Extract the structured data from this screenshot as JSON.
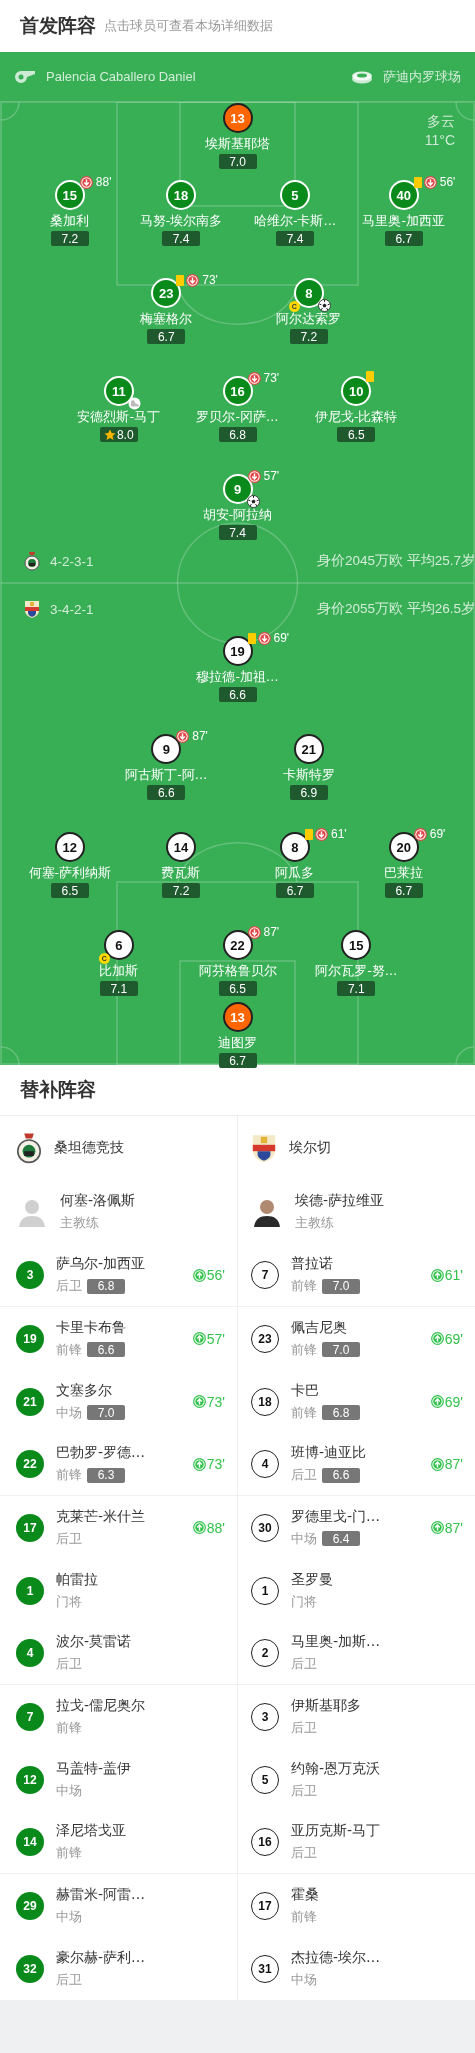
{
  "header": {
    "title": "首发阵容",
    "subtitle": "点击球员可查看本场详细数据"
  },
  "match_info": {
    "referee": "Palencia Caballero Daniel",
    "stadium": "萨迪内罗球场",
    "weather": "多云",
    "temperature": "11°C"
  },
  "home": {
    "formation": "4-2-3-1",
    "value_summary": "身价2045万欧 平均25.7岁",
    "goalkeeper": {
      "number": "13",
      "name": "埃斯基耶塔",
      "rating": "7.0"
    },
    "lines": [
      [
        {
          "number": "15",
          "name": "桑加利",
          "rating": "7.2",
          "events": [
            {
              "kind": "sub_off",
              "minute": "88'"
            }
          ]
        },
        {
          "number": "18",
          "name": "马努-埃尔南多",
          "rating": "7.4"
        },
        {
          "number": "5",
          "name": "哈维尔-卡斯…",
          "rating": "7.4"
        },
        {
          "number": "40",
          "name": "马里奥-加西亚",
          "rating": "6.7",
          "events": [
            {
              "kind": "yellow_card"
            },
            {
              "kind": "sub_off",
              "minute": "56'"
            }
          ]
        }
      ],
      [
        {
          "number": "23",
          "name": "梅塞格尔",
          "rating": "6.7",
          "events": [
            {
              "kind": "yellow_card"
            },
            {
              "kind": "sub_off",
              "minute": "73'"
            }
          ]
        },
        {
          "number": "8",
          "name": "阿尔达索罗",
          "rating": "7.2",
          "events": [
            {
              "kind": "captain",
              "label": "C"
            },
            {
              "kind": "goal"
            }
          ]
        }
      ],
      [
        {
          "number": "11",
          "name": "安德烈斯-马丁",
          "rating": "8.0",
          "events": [
            {
              "kind": "assist"
            },
            {
              "kind": "best_player"
            }
          ]
        },
        {
          "number": "16",
          "name": "罗贝尔-冈萨…",
          "rating": "6.8",
          "events": [
            {
              "kind": "sub_off",
              "minute": "73'"
            }
          ]
        },
        {
          "number": "10",
          "name": "伊尼戈-比森特",
          "rating": "6.5",
          "events": [
            {
              "kind": "yellow_card"
            }
          ]
        }
      ],
      [
        {
          "number": "9",
          "name": "胡安-阿拉纳",
          "rating": "7.4",
          "events": [
            {
              "kind": "sub_off",
              "minute": "57'"
            },
            {
              "kind": "goal"
            }
          ]
        }
      ]
    ]
  },
  "away": {
    "formation": "3-4-2-1",
    "value_summary": "身价2055万欧 平均26.5岁",
    "lines": [
      [
        {
          "number": "19",
          "name": "穆拉德-加祖…",
          "rating": "6.6",
          "events": [
            {
              "kind": "yellow_card"
            },
            {
              "kind": "sub_off",
              "minute": "69'"
            }
          ]
        }
      ],
      [
        {
          "number": "9",
          "name": "阿古斯丁-阿…",
          "rating": "6.6",
          "events": [
            {
              "kind": "sub_off",
              "minute": "87'"
            }
          ]
        },
        {
          "number": "21",
          "name": "卡斯特罗",
          "rating": "6.9"
        }
      ],
      [
        {
          "number": "12",
          "name": "何塞-萨利纳斯",
          "rating": "6.5"
        },
        {
          "number": "14",
          "name": "费瓦斯",
          "rating": "7.2"
        },
        {
          "number": "8",
          "name": "阿瓜多",
          "rating": "6.7",
          "events": [
            {
              "kind": "yellow_card"
            },
            {
              "kind": "sub_off",
              "minute": "61'"
            }
          ]
        },
        {
          "number": "20",
          "name": "巴莱拉",
          "rating": "6.7",
          "events": [
            {
              "kind": "sub_off",
              "minute": "69'"
            }
          ]
        }
      ],
      [
        {
          "number": "6",
          "name": "比加斯",
          "rating": "7.1",
          "events": [
            {
              "kind": "captain",
              "label": "C"
            }
          ]
        },
        {
          "number": "22",
          "name": "阿芬格鲁贝尔",
          "rating": "6.5",
          "events": [
            {
              "kind": "sub_off",
              "minute": "87'"
            }
          ]
        },
        {
          "number": "15",
          "name": "阿尔瓦罗-努…",
          "rating": "7.1"
        }
      ]
    ],
    "goalkeeper": {
      "number": "13",
      "name": "迪图罗",
      "rating": "6.7"
    }
  },
  "substitutes": {
    "title": "替补阵容",
    "teams": [
      {
        "name": "桑坦德竞技",
        "coach": {
          "name": "何塞-洛佩斯",
          "role": "主教练"
        },
        "players": [
          {
            "number": "3",
            "name": "萨乌尔-加西亚",
            "position": "后卫",
            "rating": "6.8",
            "sub_on": "56'"
          },
          {
            "number": "19",
            "name": "卡里卡布鲁",
            "position": "前锋",
            "rating": "6.6",
            "sub_on": "57'"
          },
          {
            "number": "21",
            "name": "文塞多尔",
            "position": "中场",
            "rating": "7.0",
            "sub_on": "73'"
          },
          {
            "number": "22",
            "name": "巴勃罗-罗德…",
            "position": "前锋",
            "rating": "6.3",
            "sub_on": "73'"
          },
          {
            "number": "17",
            "name": "克莱芒-米什兰",
            "position": "后卫",
            "sub_on": "88'"
          },
          {
            "number": "1",
            "name": "帕雷拉",
            "position": "门将"
          },
          {
            "number": "4",
            "name": "波尔-莫雷诺",
            "position": "后卫"
          },
          {
            "number": "7",
            "name": "拉戈-儒尼奥尔",
            "position": "前锋"
          },
          {
            "number": "12",
            "name": "马盖特-盖伊",
            "position": "中场"
          },
          {
            "number": "14",
            "name": "泽尼塔戈亚",
            "position": "前锋"
          },
          {
            "number": "29",
            "name": "赫雷米-阿雷…",
            "position": "中场"
          },
          {
            "number": "32",
            "name": "豪尔赫-萨利…",
            "position": "后卫"
          }
        ]
      },
      {
        "name": "埃尔切",
        "coach": {
          "name": "埃德-萨拉维亚",
          "role": "主教练"
        },
        "players": [
          {
            "number": "7",
            "name": "普拉诺",
            "position": "前锋",
            "rating": "7.0",
            "sub_on": "61'"
          },
          {
            "number": "23",
            "name": "佩吉尼奥",
            "position": "前锋",
            "rating": "7.0",
            "sub_on": "69'"
          },
          {
            "number": "18",
            "name": "卡巴",
            "position": "前锋",
            "rating": "6.8",
            "sub_on": "69'"
          },
          {
            "number": "4",
            "name": "班博-迪亚比",
            "position": "后卫",
            "rating": "6.6",
            "sub_on": "87'"
          },
          {
            "number": "30",
            "name": "罗德里戈-门…",
            "position": "中场",
            "rating": "6.4",
            "sub_on": "87'"
          },
          {
            "number": "1",
            "name": "圣罗曼",
            "position": "门将"
          },
          {
            "number": "2",
            "name": "马里奥-加斯…",
            "position": "后卫"
          },
          {
            "number": "3",
            "name": "伊斯基耶多",
            "position": "后卫"
          },
          {
            "number": "5",
            "name": "约翰-恩万克沃",
            "position": "后卫"
          },
          {
            "number": "16",
            "name": "亚历克斯-马丁",
            "position": "后卫"
          },
          {
            "number": "17",
            "name": "霍桑",
            "position": "前锋"
          },
          {
            "number": "31",
            "name": "杰拉德-埃尔…",
            "position": "中场"
          }
        ]
      }
    ]
  }
}
